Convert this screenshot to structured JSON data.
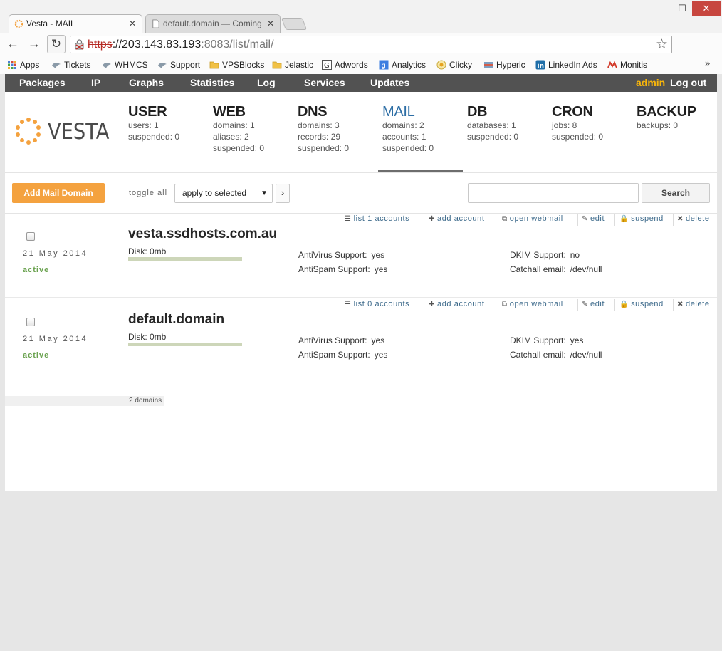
{
  "browser": {
    "tabs": [
      {
        "title": "Vesta - MAIL",
        "active": true
      },
      {
        "title": "default.domain — Coming",
        "active": false
      }
    ],
    "url": {
      "scheme": "https",
      "host": "://203.143.83.193",
      "rest": ":8083/list/mail/"
    },
    "bookmarks": [
      {
        "label": "Apps",
        "icon": "apps-grid-icon"
      },
      {
        "label": "Tickets",
        "icon": "bookmark-icon"
      },
      {
        "label": "WHMCS",
        "icon": "bookmark-icon"
      },
      {
        "label": "Support",
        "icon": "bookmark-icon"
      },
      {
        "label": "VPSBlocks",
        "icon": "folder-icon"
      },
      {
        "label": "Jelastic",
        "icon": "folder-icon"
      },
      {
        "label": "Adwords",
        "icon": "google-icon"
      },
      {
        "label": "Analytics",
        "icon": "google-icon"
      },
      {
        "label": "Clicky",
        "icon": "clicky-icon"
      },
      {
        "label": "Hyperic",
        "icon": "hyperic-icon"
      },
      {
        "label": "LinkedIn Ads",
        "icon": "linkedin-icon"
      },
      {
        "label": "Monitis",
        "icon": "monitis-icon"
      }
    ],
    "bookmarks_more": "»"
  },
  "nav": {
    "items": [
      "Packages",
      "IP",
      "Graphs",
      "Statistics",
      "Log",
      "Services",
      "Updates"
    ],
    "user": "admin",
    "logout": "Log out"
  },
  "logo_text": "VESTA",
  "stats": [
    {
      "title": "USER",
      "lines": [
        "users: 1",
        "suspended: 0"
      ]
    },
    {
      "title": "WEB",
      "lines": [
        "domains: 1",
        "aliases: 2",
        "suspended: 0"
      ]
    },
    {
      "title": "DNS",
      "lines": [
        "domains: 3",
        "records: 29",
        "suspended: 0"
      ]
    },
    {
      "title": "MAIL",
      "lines": [
        "domains: 2",
        "accounts: 1",
        "suspended: 0"
      ],
      "active": true
    },
    {
      "title": "DB",
      "lines": [
        "databases: 1",
        "suspended: 0"
      ]
    },
    {
      "title": "CRON",
      "lines": [
        "jobs: 8",
        "suspended: 0"
      ]
    },
    {
      "title": "BACKUP",
      "lines": [
        "backups: 0"
      ]
    }
  ],
  "toolbar": {
    "add_button": "Add Mail Domain",
    "toggle_all": "toggle all",
    "bulk_action": "apply to selected",
    "bulk_go": "›",
    "search_button": "Search",
    "search_value": ""
  },
  "domains": [
    {
      "name": "vesta.ssdhosts.com.au",
      "date": "21 May 2014",
      "status": "active",
      "disk": "Disk: 0mb",
      "actions": [
        "list 1 accounts",
        "add account",
        "open webmail",
        "edit",
        "suspend",
        "delete"
      ],
      "antivirus_label": "AntiVirus Support:",
      "antivirus": "yes",
      "antispam_label": "AntiSpam Support:",
      "antispam": "yes",
      "dkim_label": "DKIM Support:",
      "dkim": "no",
      "catchall_label": "Catchall email:",
      "catchall": "/dev/null"
    },
    {
      "name": "default.domain",
      "date": "21 May 2014",
      "status": "active",
      "disk": "Disk: 0mb",
      "actions": [
        "list 0 accounts",
        "add account",
        "open webmail",
        "edit",
        "suspend",
        "delete"
      ],
      "antivirus_label": "AntiVirus Support:",
      "antivirus": "yes",
      "antispam_label": "AntiSpam Support:",
      "antispam": "yes",
      "dkim_label": "DKIM Support:",
      "dkim": "yes",
      "catchall_label": "Catchall email:",
      "catchall": "/dev/null"
    }
  ],
  "footer": {
    "count": "2 domains"
  },
  "colors": {
    "accent": "#f4a23f",
    "nav_bg": "#525252",
    "active_blue": "#2d6ea5",
    "status_green": "#6aa24f",
    "user_yellow": "#f9b60a"
  }
}
